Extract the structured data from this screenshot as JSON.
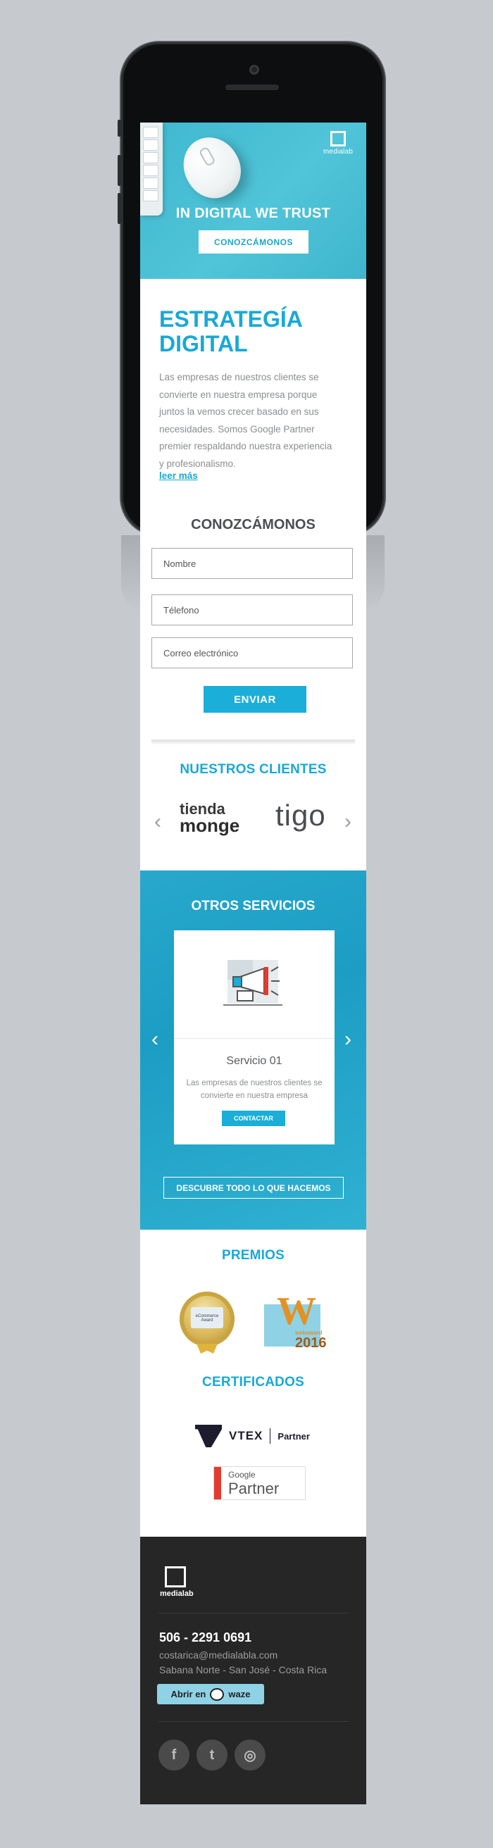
{
  "brand": {
    "name": "medialab"
  },
  "hero": {
    "title": "IN DIGITAL WE TRUST",
    "cta": "CONOZCÁMONOS"
  },
  "strategy": {
    "title": "ESTRATEGÍA DIGITAL",
    "text": "Las empresas de nuestros clientes se convierte en nuestra empresa porque juntos la vemos crecer basado en sus necesidades. Somos Google Partner premier respaldando nuestra experiencia y profesionalismo.",
    "link": "leer más"
  },
  "contact_form": {
    "title": "CONOZCÁMONOS",
    "fields": [
      "Nombre",
      "Télefono",
      "Correo electrónico"
    ],
    "submit": "ENVIAR"
  },
  "clients": {
    "title": "NUESTROS CLIENTES",
    "logos": [
      {
        "line1": "tienda",
        "line2": "monge"
      },
      {
        "name": "tigo"
      }
    ],
    "prev_icon": "chevron-left-icon",
    "next_icon": "chevron-right-icon"
  },
  "services": {
    "title": "OTROS SERVICIOS",
    "card": {
      "icon": "megaphone-icon",
      "name": "Servicio 01",
      "description": "Las empresas de nuestros clientes se convierte en nuestra empresa",
      "button": "CONTACTAR"
    },
    "discover": "DESCUBRE TODO LO QUE HACEMOS"
  },
  "awards": {
    "title": "PREMIOS",
    "items": [
      {
        "label": "eCommerce Award"
      },
      {
        "letter": "W",
        "label": "webaward",
        "year": "2016"
      }
    ]
  },
  "certificates": {
    "title": "CERTIFICADOS",
    "vtex": {
      "name": "VTEX",
      "label": "Partner"
    },
    "google": {
      "top": "Google",
      "bottom": "Partner"
    }
  },
  "footer": {
    "phone": "506 - 2291 0691",
    "email": "costarica@medialabla.com",
    "address": "Sabana Norte - San José - Costa Rica",
    "waze_prefix": "Abrir en",
    "waze_name": "waze",
    "social": [
      {
        "icon": "facebook-icon",
        "glyph": "f"
      },
      {
        "icon": "twitter-icon",
        "glyph": "t"
      },
      {
        "icon": "instagram-icon",
        "glyph": "◎"
      }
    ]
  },
  "colors": {
    "accent": "#19a9d6",
    "hero": "#4ec2d6",
    "footer": "#262626",
    "background": "#c6c9ce"
  }
}
